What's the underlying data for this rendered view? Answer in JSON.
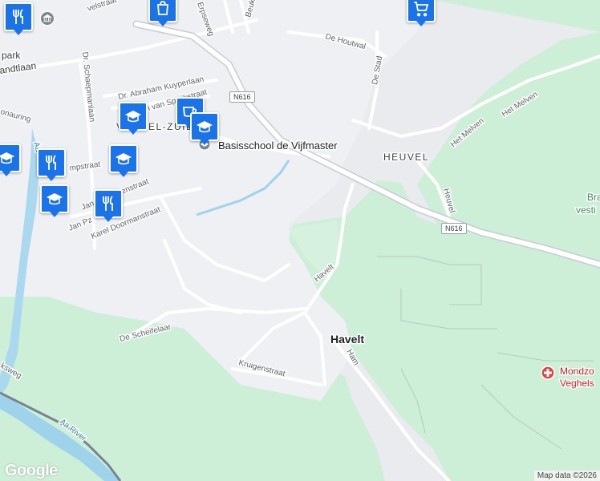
{
  "map": {
    "places": {
      "havelt": "Havelt",
      "heuvel": "HEUVEL",
      "school": "Basisschool de Vijfmaster",
      "veghel_zuid": "VEGHEL-ZUID",
      "braak_partial": "Bra",
      "vesti_partial": "vesti",
      "mondzorg_partial": "Mondzo",
      "veghels_partial": "Veghels",
      "park_partial": "park"
    },
    "streets": {
      "erpseweg": "Erpseweg",
      "beukelaan": "Beukela",
      "de_houtwal": "De Houtwal",
      "de_stad": "De Stad",
      "het_melven_1": "Het Melven",
      "het_melven_2": "Het Melven",
      "heuvel_road": "Heuvel",
      "havelt_road": "Havelt",
      "ham": "Ham",
      "kruigenstraat": "Kruigenstraat",
      "de_scheifelaar": "De Scheifelaar",
      "karel_doorman": "Karel Doormanstraat",
      "jan_pz": "Jan Pz",
      "jan_galen": "Jan van Galenstraat",
      "dr_schaepman": "Dr. Schaepmanlaan",
      "dr_kuyper": "Dr. Abraham Kuyperlaan",
      "van_speijk": "Jan van Speijkstraat",
      "velstraat": "velstraat",
      "andtlaan": "andtlaan",
      "mpstraat": "mpstraat",
      "aa_river": "Aa River",
      "ksweg": "ksweg",
      "onauring": "onauring",
      "aa": "Aa"
    },
    "road_shields": [
      "N616",
      "N616"
    ],
    "icons": [
      "restaurant-icon",
      "museum-icon",
      "shopping-icon",
      "shopping-cart-icon",
      "cafe-icon",
      "school-icon",
      "school-icon",
      "school-icon",
      "school-icon",
      "restaurant-icon",
      "restaurant-icon",
      "school-icon",
      "hospital-icon"
    ],
    "logo": "Google",
    "attribution": "Map data ©2026"
  },
  "colors": {
    "background": "#e9ebee",
    "green": "#cdefd8",
    "water": "#9fd3ec",
    "pin": "#1a73e8",
    "hospital": "#e33f3a"
  }
}
